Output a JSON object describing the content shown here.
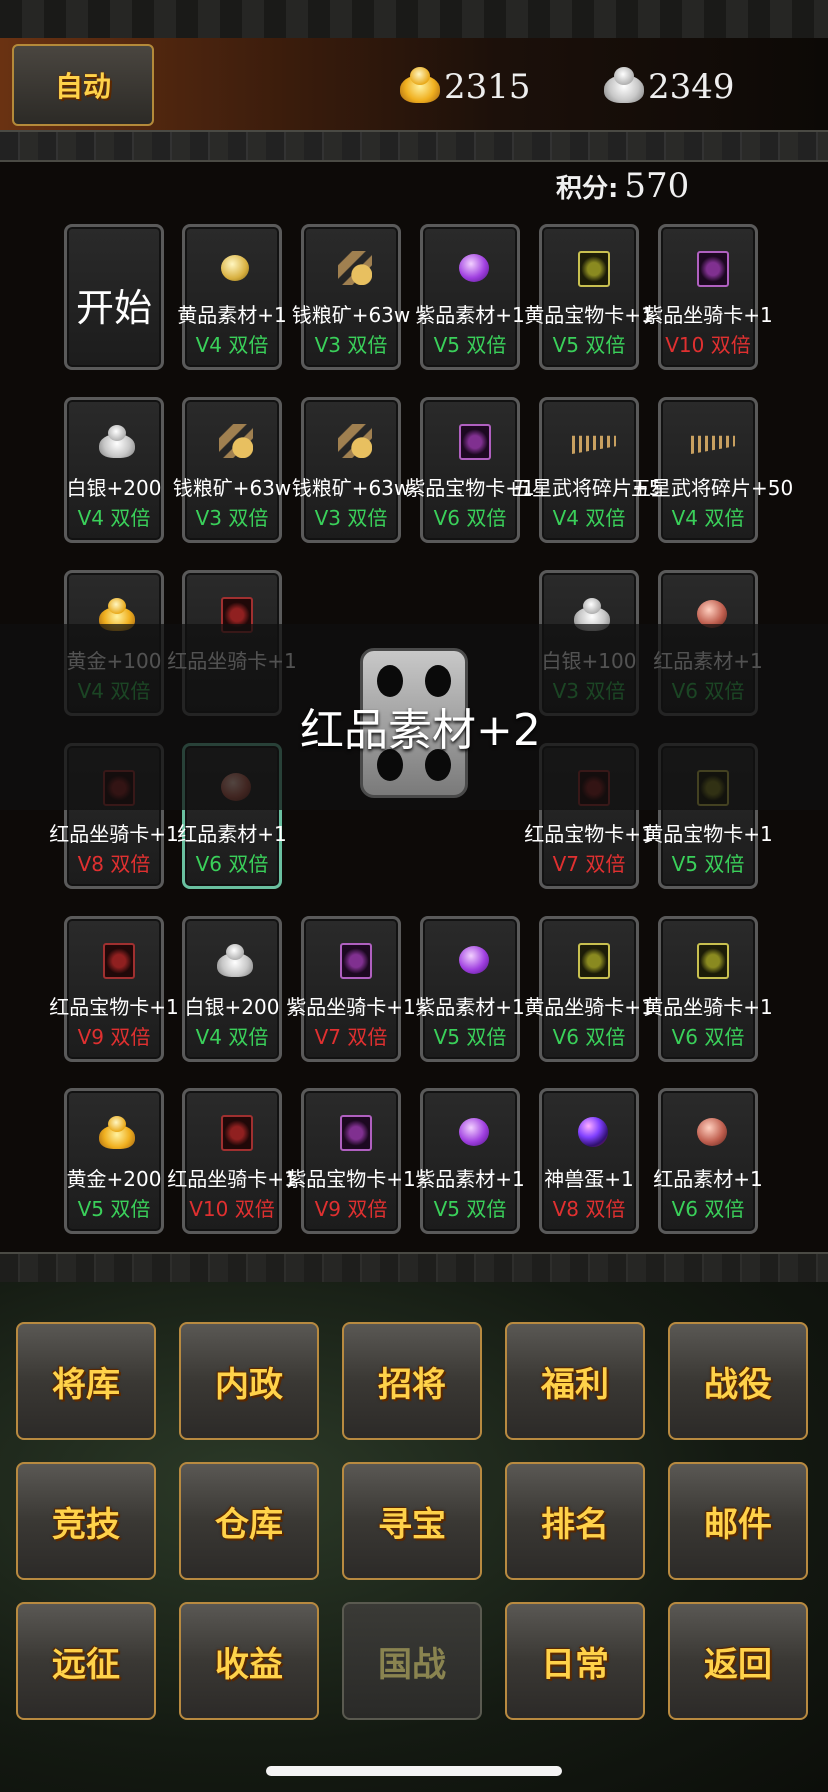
{
  "header": {
    "auto_label": "自动",
    "gold": "2315",
    "silver": "2349"
  },
  "score": {
    "label": "积分:",
    "value": "570"
  },
  "board": {
    "start_label": "开始",
    "cells": [
      {
        "name": "黄品素材+1",
        "mult": "V4 双倍",
        "color": "#3ad05a",
        "icon": "yellow-material-icon"
      },
      {
        "name": "钱粮矿+63w",
        "mult": "V3 双倍",
        "color": "#3ad05a",
        "icon": "grain-ore-icon"
      },
      {
        "name": "紫品素材+1",
        "mult": "V5 双倍",
        "color": "#3ad05a",
        "icon": "purple-material-icon"
      },
      {
        "name": "黄品宝物卡+1",
        "mult": "V5 双倍",
        "color": "#3ad05a",
        "icon": "yellow-treasure-card-icon"
      },
      {
        "name": "紫品坐骑卡+1",
        "mult": "V10 双倍",
        "color": "#e03030",
        "icon": "purple-mount-card-icon"
      },
      {
        "name": "白银+200",
        "mult": "V4 双倍",
        "color": "#3ad05a",
        "icon": "silver-icon"
      },
      {
        "name": "钱粮矿+63w",
        "mult": "V3 双倍",
        "color": "#3ad05a",
        "icon": "grain-ore-icon"
      },
      {
        "name": "钱粮矿+63w",
        "mult": "V3 双倍",
        "color": "#3ad05a",
        "icon": "grain-ore-icon"
      },
      {
        "name": "紫品宝物卡+1",
        "mult": "V6 双倍",
        "color": "#3ad05a",
        "icon": "purple-treasure-card-icon"
      },
      {
        "name": "五星武将碎片+50",
        "mult": "V4 双倍",
        "color": "#3ad05a",
        "icon": "general-fragment-icon"
      },
      {
        "name": "五星武将碎片+50",
        "mult": "V4 双倍",
        "color": "#3ad05a",
        "icon": "general-fragment-icon"
      },
      {
        "name": "黄金+100",
        "mult": "V4 双倍",
        "color": "#3ad05a",
        "icon": "gold-icon"
      },
      {
        "name": "红品坐骑卡+1",
        "mult": "",
        "color": "#3ad05a",
        "icon": "red-mount-card-icon"
      },
      {
        "name": "白银+100",
        "mult": "V3 双倍",
        "color": "#3ad05a",
        "icon": "silver-icon"
      },
      {
        "name": "红品素材+1",
        "mult": "V6 双倍",
        "color": "#3ad05a",
        "icon": "red-material-icon"
      },
      {
        "name": "红品坐骑卡+1",
        "mult": "V8 双倍",
        "color": "#e03030",
        "icon": "red-mount-card-icon"
      },
      {
        "name": "红品素材+1",
        "mult": "V6 双倍",
        "color": "#3ad05a",
        "icon": "red-material-icon"
      },
      {
        "name": "红品宝物卡+1",
        "mult": "V7 双倍",
        "color": "#e03030",
        "icon": "red-treasure-card-icon"
      },
      {
        "name": "黄品宝物卡+1",
        "mult": "V5 双倍",
        "color": "#3ad05a",
        "icon": "yellow-treasure-card-icon"
      },
      {
        "name": "红品宝物卡+1",
        "mult": "V9 双倍",
        "color": "#e03030",
        "icon": "red-treasure-card-icon"
      },
      {
        "name": "白银+200",
        "mult": "V4 双倍",
        "color": "#3ad05a",
        "icon": "silver-icon"
      },
      {
        "name": "紫品坐骑卡+1",
        "mult": "V7 双倍",
        "color": "#e03030",
        "icon": "purple-mount-card-icon"
      },
      {
        "name": "紫品素材+1",
        "mult": "V5 双倍",
        "color": "#3ad05a",
        "icon": "purple-material-icon"
      },
      {
        "name": "黄品坐骑卡+1",
        "mult": "V6 双倍",
        "color": "#3ad05a",
        "icon": "yellow-mount-card-icon"
      },
      {
        "name": "黄品坐骑卡+1",
        "mult": "V6 双倍",
        "color": "#3ad05a",
        "icon": "yellow-mount-card-icon"
      },
      {
        "name": "黄金+200",
        "mult": "V5 双倍",
        "color": "#3ad05a",
        "icon": "gold-icon"
      },
      {
        "name": "红品坐骑卡+1",
        "mult": "V10 双倍",
        "color": "#e03030",
        "icon": "red-mount-card-icon"
      },
      {
        "name": "紫品宝物卡+1",
        "mult": "V9 双倍",
        "color": "#e03030",
        "icon": "purple-treasure-card-icon"
      },
      {
        "name": "紫品素材+1",
        "mult": "V5 双倍",
        "color": "#3ad05a",
        "icon": "purple-material-icon"
      },
      {
        "name": "神兽蛋+1",
        "mult": "V8 双倍",
        "color": "#e03030",
        "icon": "beast-egg-icon"
      },
      {
        "name": "红品素材+1",
        "mult": "V6 双倍",
        "color": "#3ad05a",
        "icon": "red-material-icon"
      }
    ]
  },
  "roll_result": "红品素材+2",
  "menu": {
    "buttons": [
      "将库",
      "内政",
      "招将",
      "福利",
      "战役",
      "竞技",
      "仓库",
      "寻宝",
      "排名",
      "邮件",
      "远征",
      "收益",
      "国战",
      "日常",
      "返回"
    ]
  }
}
